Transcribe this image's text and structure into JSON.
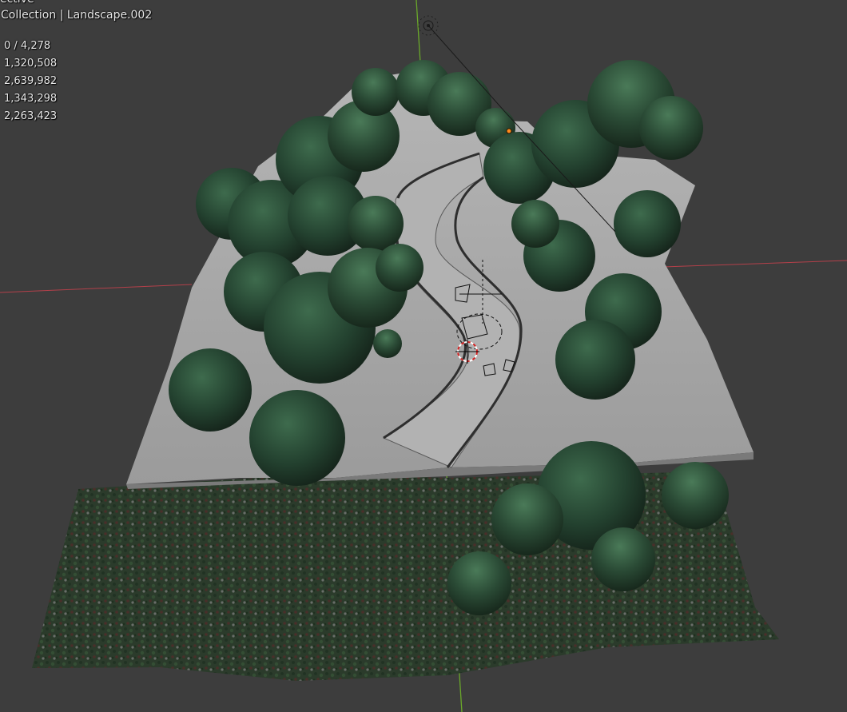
{
  "viewport": {
    "view_mode": "ective",
    "collection_label": "Collection | Landscape.002",
    "stats": [
      "0 / 4,278",
      "1,320,508",
      "2,639,982",
      "1,343,298",
      "2,263,423"
    ]
  },
  "colors": {
    "background": "#3d3d3d",
    "terrain": "#a9a9a9",
    "foliage_dark": "#1f3a2a",
    "foliage_light": "#2f5a3f",
    "x_axis": "#c8404a",
    "y_axis": "#6fb02a",
    "origin_dot": "#ff8a1e"
  },
  "scene": {
    "objects": [
      "terrain",
      "road",
      "guardrails",
      "trees",
      "grass-field",
      "camera",
      "light",
      "3d-cursor"
    ]
  }
}
